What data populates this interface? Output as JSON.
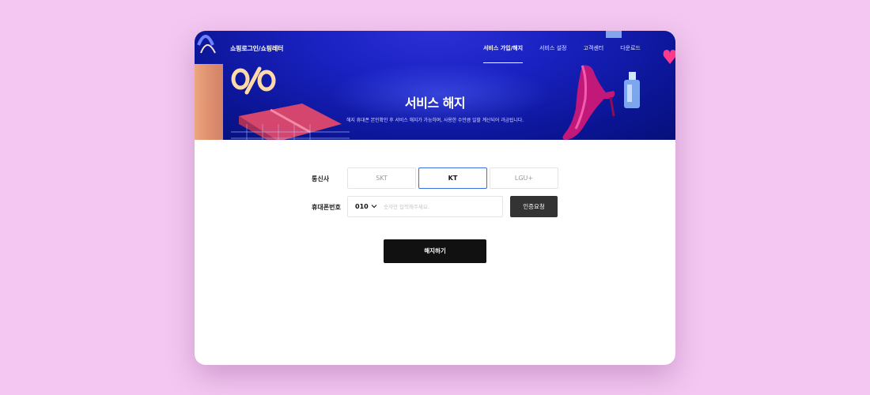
{
  "header": {
    "brand": "쇼핑로그인/쇼핑레터",
    "nav": [
      {
        "label": "서비스 가입/해지",
        "active": true
      },
      {
        "label": "서비스 설정",
        "active": false
      },
      {
        "label": "고객센터",
        "active": false
      },
      {
        "label": "다운로드",
        "active": false
      }
    ]
  },
  "hero": {
    "title": "서비스 해지",
    "subtitle": "해지 휴대폰 본인확인 후 서비스 해지가 가능하며, 사용한 수만큼 일할 계산되어 과금됩니다."
  },
  "form": {
    "carrier_label": "통신사",
    "carriers": [
      {
        "label": "SKT",
        "selected": false
      },
      {
        "label": "KT",
        "selected": true
      },
      {
        "label": "LGU+",
        "selected": false
      }
    ],
    "phone_label": "휴대폰번호",
    "phone_prefix": "010",
    "phone_placeholder": "숫자만 입력해주세요.",
    "verify_button": "인증요청",
    "submit_button": "해지하기"
  },
  "colors": {
    "page_background": "#f3c7f1",
    "hero_blue": "#1a22c2",
    "selected_border": "#3b6fe0",
    "verify_button": "#333333",
    "submit_button": "#111111"
  }
}
